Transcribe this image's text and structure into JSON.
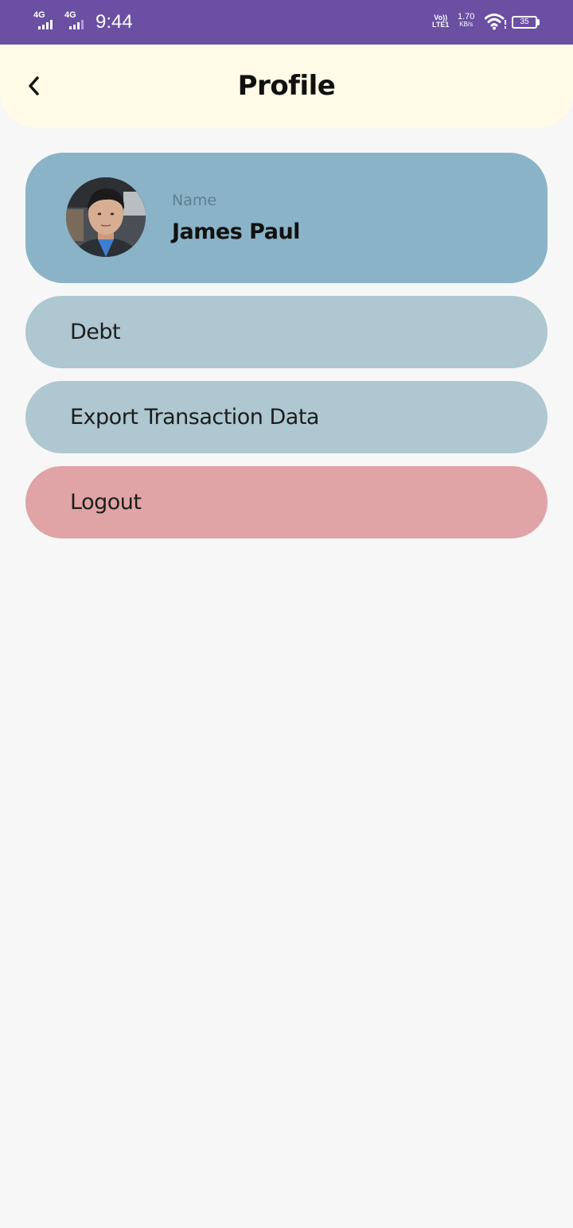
{
  "status_bar": {
    "sim1_network": "4G",
    "sim2_network": "4G",
    "time": "9:44",
    "volte_line1": "Vo))",
    "volte_line2": "LTE1",
    "speed_value": "1.70",
    "speed_unit": "KB/s",
    "battery_level": "35",
    "icons": [
      "signal-icon",
      "signal-icon",
      "volte-icon",
      "wifi-icon",
      "battery-icon"
    ]
  },
  "header": {
    "title": "Profile",
    "back_icon": "chevron-left-icon"
  },
  "profile": {
    "name_label": "Name",
    "name_value": "James Paul"
  },
  "menu": {
    "debt_label": "Debt",
    "export_label": "Export Transaction Data",
    "logout_label": "Logout"
  },
  "colors": {
    "status_bar": "#6a4fa3",
    "header_bg": "#fffbe6",
    "page_bg": "#f7f7f7",
    "profile_card": "#8ab3c7",
    "menu_item": "#aec7d0",
    "logout": "#e0a4a6"
  }
}
